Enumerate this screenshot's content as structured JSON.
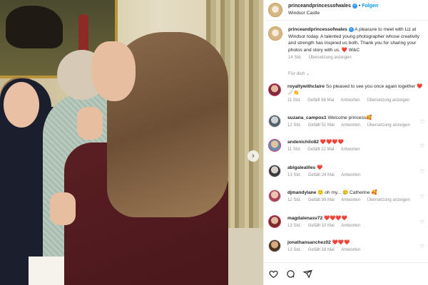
{
  "post": {
    "username": "princeandprincessofwales",
    "verified_mark": "✓",
    "separator": "•",
    "follow_label": "Folgen",
    "location": "Windsor Castle"
  },
  "caption": {
    "username": "princeandprincessofwales",
    "verified_mark": "✓",
    "text": "A pleasure to meet with Liz at Windsor today. A talented young photographer whose creativity and strength has inspired us both. Thank you for sharing your photos and story with us. ❤️ W&C",
    "time": "14 Std.",
    "translate": "Übersetzung anzeigen"
  },
  "for_you_label": "Für dich ⌄",
  "comments": [
    {
      "user": "royaltywithclaire",
      "text": "So pleased to see you once again together ❤️🩹👏",
      "time": "11 Std.",
      "likes": "Gefällt 68 Mal",
      "reply": "Antworten",
      "translate": "Übersetzung anzeigen"
    },
    {
      "user": "suzana_campos1",
      "text": "Welcome princess🥰",
      "time": "12 Std.",
      "likes": "Gefällt 51 Mal",
      "reply": "Antworten",
      "translate": "Übersetzung anzeigen"
    },
    {
      "user": "andenichilo82",
      "text": "❤️❤️❤️❤️",
      "time": "11 Std.",
      "likes": "Gefällt 22 Mal",
      "reply": "Antworten",
      "translate": ""
    },
    {
      "user": "abigalealiles",
      "text": "❤️",
      "time": "13 Std.",
      "likes": "Gefällt 24 Mal",
      "reply": "Antworten",
      "translate": ""
    },
    {
      "user": "djmandylane",
      "text": "🙂 oh my... 🥲 Catherine 🥰",
      "time": "12 Std.",
      "likes": "Gefällt 89 Mal",
      "reply": "Antworten",
      "translate": "Übersetzung anzeigen"
    },
    {
      "user": "magdalenasv72",
      "text": "❤️❤️❤️❤️",
      "time": "13 Std.",
      "likes": "Gefällt 10 Mal",
      "reply": "Antworten",
      "translate": ""
    },
    {
      "user": "jonathansanchez02",
      "text": "❤️❤️❤️",
      "time": "13 Std.",
      "likes": "Gefällt 18 Mal",
      "reply": "Antworten",
      "translate": ""
    }
  ],
  "icons": {
    "like": "heart-icon",
    "comment": "comment-icon",
    "share": "share-icon",
    "next": "chevron-right-icon",
    "comment_like": "heart-icon"
  },
  "colors": {
    "follow": "#0095f6",
    "verified": "#3897f0",
    "meta_text": "#8e8e8e"
  },
  "ui": {
    "next_arrow": "›",
    "comment_heart": "♡"
  }
}
